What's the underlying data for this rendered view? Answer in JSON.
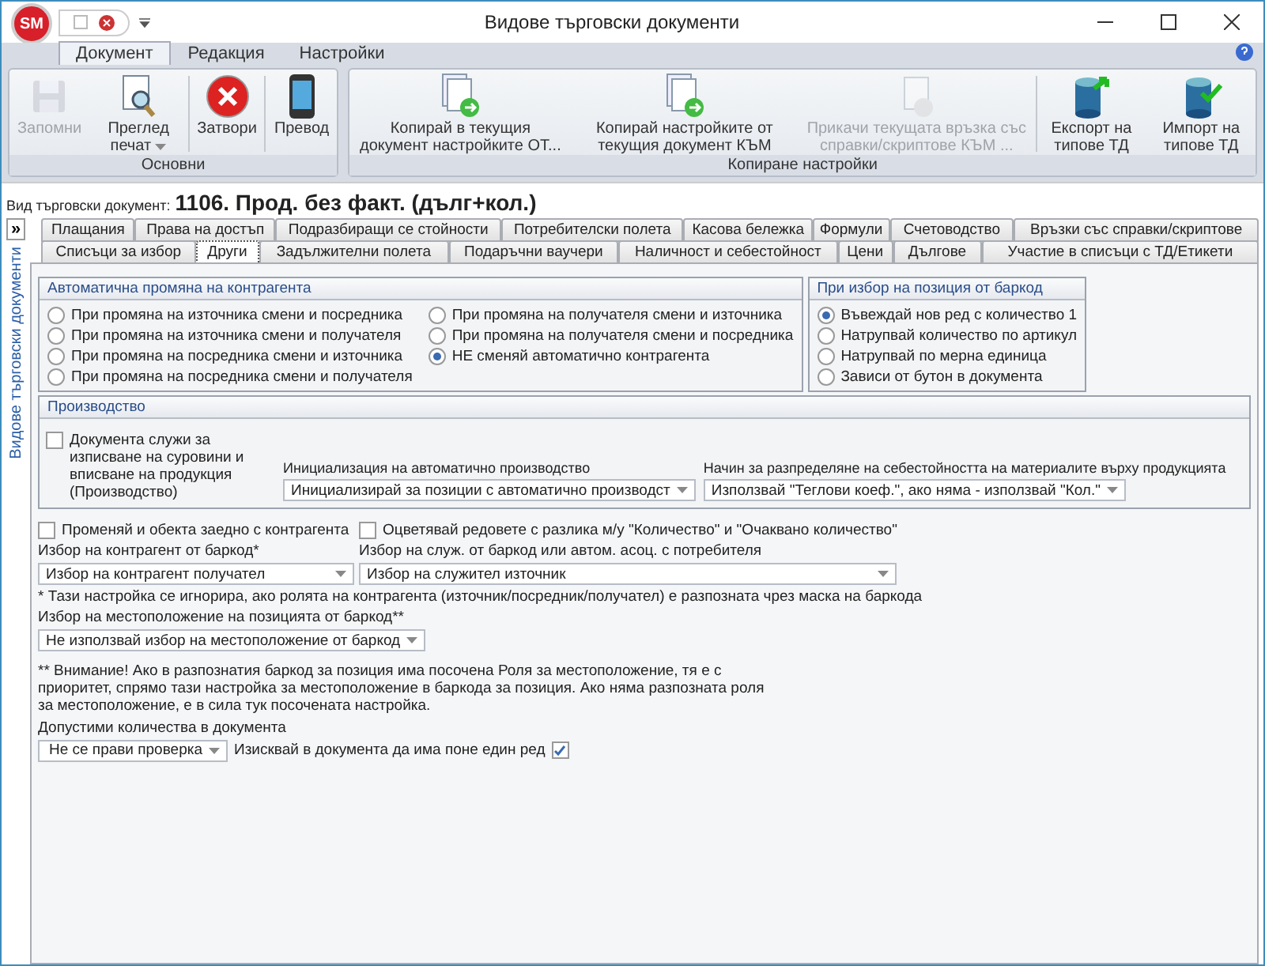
{
  "window": {
    "title": "Видове търговски документи",
    "logo": "SM"
  },
  "ribbon": {
    "tabs": [
      {
        "label": "Документ",
        "selected": true
      },
      {
        "label": "Редакция",
        "selected": false
      },
      {
        "label": "Настройки",
        "selected": false
      }
    ],
    "groups": [
      {
        "label": "Основни",
        "buttons": [
          {
            "label": "Запомни",
            "kind": "save",
            "disabled": true,
            "dropdown": false
          },
          {
            "label": "Преглед печат",
            "kind": "preview",
            "disabled": false,
            "dropdown": true
          },
          {
            "label": "Затвори",
            "kind": "close",
            "disabled": false,
            "dropdown": false
          },
          {
            "label": "Превод",
            "kind": "phone",
            "disabled": false,
            "dropdown": false
          }
        ]
      },
      {
        "label": "Копиране настройки",
        "buttons": [
          {
            "label": "Копирай в текущия документ настройките ОТ...",
            "kind": "copy",
            "disabled": false,
            "dropdown": false
          },
          {
            "label": "Копирай настройките от текущия документ КЪМ",
            "kind": "copy",
            "disabled": false,
            "dropdown": false
          },
          {
            "label": "Прикачи текущата връзка със справки/скриптове КЪМ ...",
            "kind": "attach",
            "disabled": true,
            "dropdown": false
          },
          {
            "label": "Експорт на типове ТД",
            "kind": "export",
            "disabled": false,
            "dropdown": false
          },
          {
            "label": "Импорт на типове ТД",
            "kind": "import",
            "disabled": false,
            "dropdown": false
          }
        ]
      }
    ]
  },
  "doc_type": {
    "label": "Вид търговски документ:",
    "value": "1106. Прод. без факт. (дълг+кол.)"
  },
  "side_panel": {
    "toggle": "»",
    "label": "Видове търговски документи"
  },
  "tab_rows": [
    {
      "tabs": [
        {
          "label": "Плащания",
          "selected": false
        },
        {
          "label": "Права на достъп",
          "selected": false
        },
        {
          "label": "Подразбиращи се стойности",
          "selected": false
        },
        {
          "label": "Потребителски полета",
          "selected": false
        },
        {
          "label": "Касова бележка",
          "selected": false
        },
        {
          "label": "Формули",
          "selected": false
        },
        {
          "label": "Счетоводство",
          "selected": false
        },
        {
          "label": "Връзки със справки/скриптове",
          "selected": false
        }
      ]
    },
    {
      "tabs": [
        {
          "label": "Списъци за избор",
          "selected": false
        },
        {
          "label": "Други",
          "selected": true
        },
        {
          "label": "Задължителни полета",
          "selected": false
        },
        {
          "label": "Подаръчни ваучери",
          "selected": false
        },
        {
          "label": "Наличност и себестойност",
          "selected": false
        },
        {
          "label": "Цени",
          "selected": false
        },
        {
          "label": "Дългове",
          "selected": false
        },
        {
          "label": "Участие в списъци с ТД/Етикети",
          "selected": false
        }
      ]
    }
  ],
  "auto_partner": {
    "title": "Автоматична промяна на контрагента",
    "options": [
      {
        "label": "При промяна на източника смени и посредника",
        "selected": false
      },
      {
        "label": "При промяна на източника смени и получателя",
        "selected": false
      },
      {
        "label": "При промяна на посредника смени и източника",
        "selected": false
      },
      {
        "label": "При промяна на посредника смени и получателя",
        "selected": false
      },
      {
        "label": "При промяна на получателя смени и източника",
        "selected": false
      },
      {
        "label": "При промяна на получателя смени и посредника",
        "selected": false
      },
      {
        "label": "НЕ сменяй автоматично контрагента",
        "selected": true
      }
    ]
  },
  "barcode_position": {
    "title": "При избор на позиция от баркод",
    "options": [
      {
        "label": "Въвеждай нов ред с количество 1",
        "selected": true
      },
      {
        "label": "Натрупвай количество по артикул",
        "selected": false
      },
      {
        "label": "Натрупвай по мерна единица",
        "selected": false
      },
      {
        "label": "Зависи от бутон в документа",
        "selected": false
      }
    ]
  },
  "production": {
    "title": "Производство",
    "checkbox": {
      "label": "Документа служи за изписване на суровини и вписване на продукция (Производство)",
      "checked": false
    },
    "init_label": "Инициализация на автоматично производство",
    "init_value": "Инициализирай за позиции с автоматично производст",
    "distribution_label": "Начин за разпределяне на себестойността на материалите върху продукцията",
    "distribution_value": "Използвай \"Теглови коеф.\", ако няма - използвай \"Кол.\""
  },
  "settings": {
    "change_object": {
      "label": "Променяй и обекта заедно с контрагента",
      "checked": false
    },
    "highlight_rows": {
      "label": "Оцветявай редовете с разлика м/у \"Количество\" и \"Очаквано количество\"",
      "checked": false
    },
    "partner_from_barcode": {
      "label": "Избор на контрагент от баркод*",
      "value": "Избор на контрагент получател"
    },
    "employee_from_barcode": {
      "label": "Избор на служ. от баркод или автом. асоц. с потребителя",
      "value": "Избор на служител източник"
    },
    "note": "* Тази настройка се игнорира, ако ролята на контрагента (източник/посредник/получател) е разпозната чрез маска на баркода",
    "location_from_barcode": {
      "label": "Избор на местоположение на позицията от баркод**",
      "value": "Не използвай избор на местоположение от баркод"
    },
    "location_note": "** Внимание! Ако в разпознатия баркод за позиция има посочена Роля за местоположение, тя е с приоритет, спрямо тази настройка за местоположение в баркода за позиция. Ако няма разпозната роля за местоположение, е в сила тук посочената настройка.",
    "allowed_quantities": {
      "label": "Допустими количества в документа",
      "value": "Не се прави проверка"
    },
    "require_row": {
      "label": "Изисквай в документа да има поне един ред",
      "checked": true
    }
  }
}
